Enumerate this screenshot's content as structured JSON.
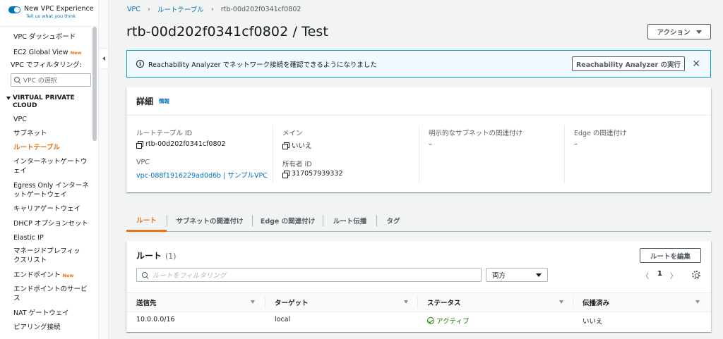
{
  "sidebar": {
    "experience_title": "New VPC Experience",
    "experience_link": "Tell us what you think",
    "items_top": [
      {
        "label": "VPC ダッシュボード",
        "badge": ""
      },
      {
        "label": "EC2 Global View",
        "badge": "New"
      }
    ],
    "filter_label": "VPC でフィルタリング:",
    "filter_placeholder": "VPC の選択",
    "section_title": "VIRTUAL PRIVATE CLOUD",
    "items": [
      {
        "label": "VPC",
        "badge": ""
      },
      {
        "label": "サブネット",
        "badge": ""
      },
      {
        "label": "ルートテーブル",
        "badge": ""
      },
      {
        "label": "インターネットゲートウェイ",
        "badge": ""
      },
      {
        "label": "Egress Only インターネットゲートウェイ",
        "badge": ""
      },
      {
        "label": "キャリアゲートウェイ",
        "badge": ""
      },
      {
        "label": "DHCP オプションセット",
        "badge": ""
      },
      {
        "label": "Elastic IP",
        "badge": ""
      },
      {
        "label": "マネージドプレフィックスリスト",
        "badge": ""
      },
      {
        "label": "エンドポイント",
        "badge": "New"
      },
      {
        "label": "エンドポイントのサービス",
        "badge": ""
      },
      {
        "label": "NAT ゲートウェイ",
        "badge": ""
      },
      {
        "label": "ピアリング接続",
        "badge": ""
      }
    ]
  },
  "breadcrumb": [
    "VPC",
    "ルートテーブル",
    "rtb-00d202f0341cf0802"
  ],
  "page_title": "rtb-00d202f0341cf0802 / Test",
  "actions_label": "アクション",
  "banner": {
    "text": "Reachability Analyzer でネットワーク接続を確認できるようになりました",
    "button": "Reachability Analyzer の実行",
    "close": "✕"
  },
  "details": {
    "title": "詳細",
    "info": "情報",
    "fields": {
      "route_table_id_label": "ルートテーブル ID",
      "route_table_id": "rtb-00d202f0341cf0802",
      "main_label": "メイン",
      "main": "いいえ",
      "explicit_subnet_label": "明示的なサブネットの関連付け",
      "explicit_subnet": "–",
      "edge_label": "Edge の関連付け",
      "edge": "–",
      "vpc_label": "VPC",
      "vpc": "vpc-088f1916229ad0d6b | サンプルVPC",
      "owner_label": "所有者 ID",
      "owner": "317057939332"
    }
  },
  "tabs": [
    "ルート",
    "サブネットの関連付け",
    "Edge の関連付け",
    "ルート伝播",
    "タグ"
  ],
  "routes": {
    "title": "ルート",
    "count": "(1)",
    "edit_button": "ルートを編集",
    "filter_placeholder": "ルートをフィルタリング",
    "select_value": "両方",
    "page": "1",
    "prev": "〈",
    "next": "〉",
    "columns": [
      "送信先",
      "ターゲット",
      "ステータス",
      "伝播済み"
    ],
    "rows": [
      {
        "destination": "10.0.0.0/16",
        "target": "local",
        "status": "アクティブ",
        "propagated": "いいえ"
      }
    ]
  },
  "colors": {
    "accent": "#ec7211",
    "link": "#0073bb",
    "success": "#1d8102",
    "info_border": "#00a1c9"
  }
}
